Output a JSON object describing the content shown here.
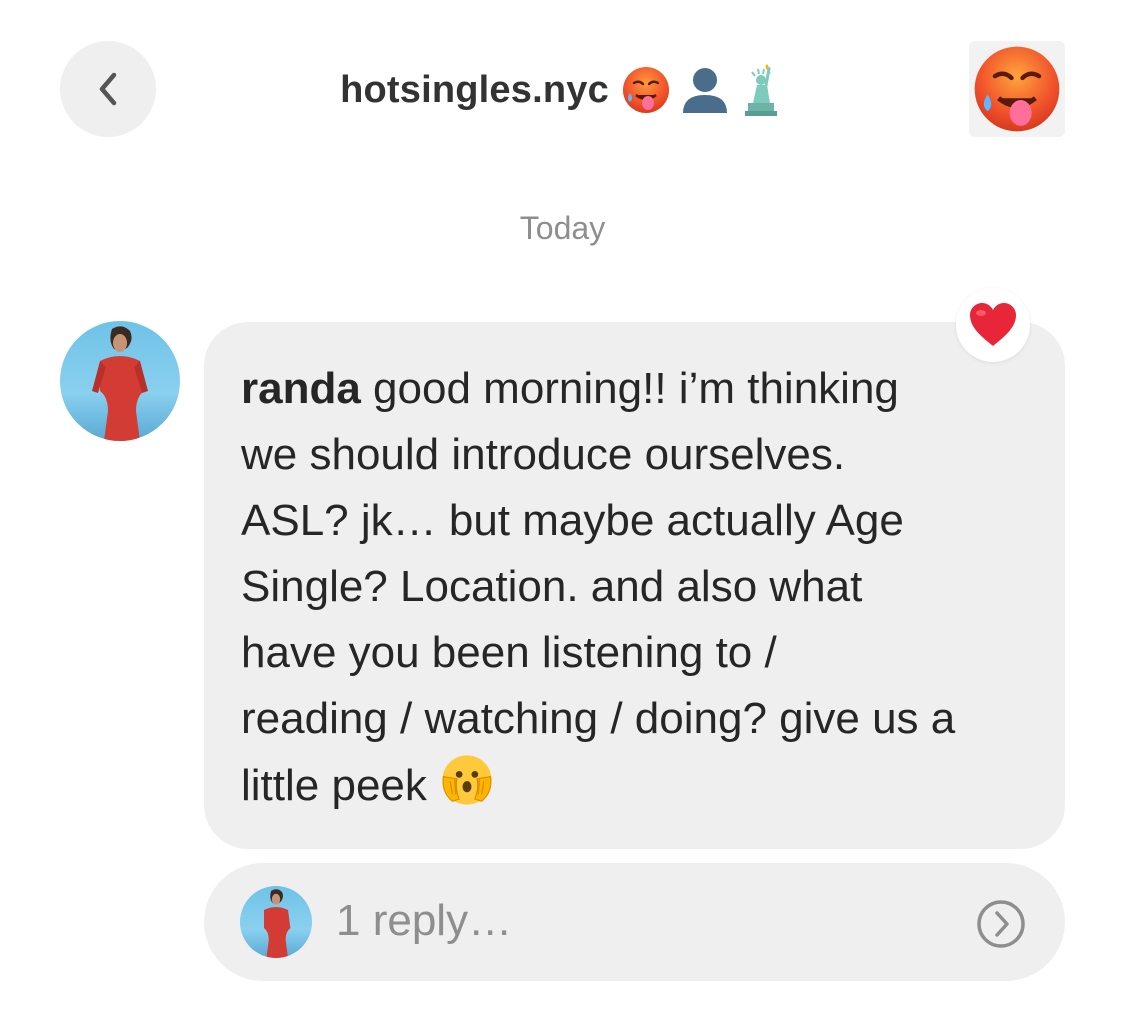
{
  "header": {
    "title": "hotsingles.nyc",
    "title_emoji": [
      "hot-face",
      "silhouette",
      "statue-of-liberty"
    ],
    "back_icon": "chevron-left-icon",
    "group_icon": "hot-face-emoji"
  },
  "date_separator": "Today",
  "message": {
    "sender": "randa",
    "lines": [
      " good morning!! i’m thinking",
      "we should introduce ourselves.",
      "ASL? jk… but maybe actually Age",
      "Single? Location. and also what",
      "have you been listening to /",
      "reading / watching / doing? give us a",
      "little peek"
    ],
    "trailing_emoji": "face-with-hand-over-mouth",
    "reaction": "red-heart"
  },
  "replies": {
    "label": "1 reply…",
    "icon": "chevron-right-circle-icon"
  },
  "colors": {
    "bubble": "#efefef",
    "text": "#262626",
    "muted": "#8e8e8e",
    "heart": "#e8263a"
  }
}
